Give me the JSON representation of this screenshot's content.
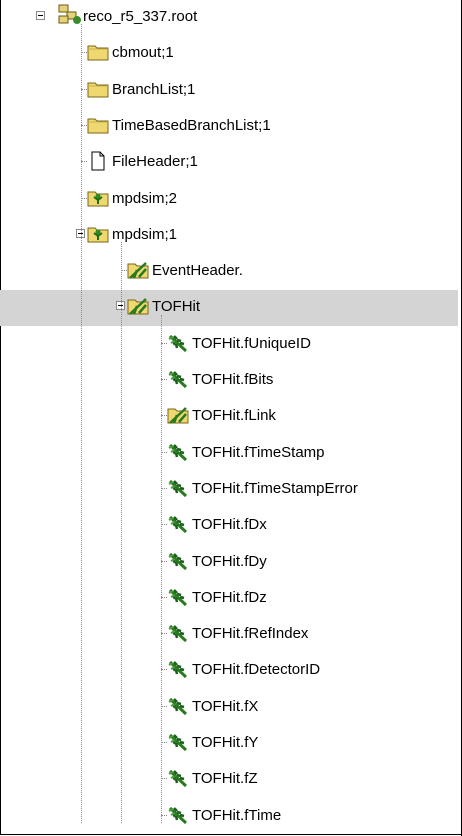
{
  "tree": {
    "root": {
      "label": "reco_r5_337.root",
      "icon": "root-file-icon",
      "expanded": true
    },
    "items": [
      {
        "label": "cbmout;1",
        "icon": "folder-icon"
      },
      {
        "label": "BranchList;1",
        "icon": "folder-icon"
      },
      {
        "label": "TimeBasedBranchList;1",
        "icon": "folder-icon"
      },
      {
        "label": "FileHeader;1",
        "icon": "file-icon"
      },
      {
        "label": "mpdsim;2",
        "icon": "tree-icon"
      },
      {
        "label": "mpdsim;1",
        "icon": "tree-icon",
        "expanded": true,
        "children": [
          {
            "label": "EventHeader.",
            "icon": "branch-icon"
          },
          {
            "label": "TOFHit",
            "icon": "branch-icon",
            "expanded": true,
            "selected": true,
            "children": [
              {
                "label": "TOFHit.fUniqueID",
                "icon": "leaf-icon"
              },
              {
                "label": "TOFHit.fBits",
                "icon": "leaf-icon"
              },
              {
                "label": "TOFHit.fLink",
                "icon": "branch-icon"
              },
              {
                "label": "TOFHit.fTimeStamp",
                "icon": "leaf-icon"
              },
              {
                "label": "TOFHit.fTimeStampError",
                "icon": "leaf-icon"
              },
              {
                "label": "TOFHit.fDx",
                "icon": "leaf-icon"
              },
              {
                "label": "TOFHit.fDy",
                "icon": "leaf-icon"
              },
              {
                "label": "TOFHit.fDz",
                "icon": "leaf-icon"
              },
              {
                "label": "TOFHit.fRefIndex",
                "icon": "leaf-icon"
              },
              {
                "label": "TOFHit.fDetectorID",
                "icon": "leaf-icon"
              },
              {
                "label": "TOFHit.fX",
                "icon": "leaf-icon"
              },
              {
                "label": "TOFHit.fY",
                "icon": "leaf-icon"
              },
              {
                "label": "TOFHit.fZ",
                "icon": "leaf-icon"
              },
              {
                "label": "TOFHit.fTime",
                "icon": "leaf-icon"
              }
            ]
          }
        ]
      }
    ]
  },
  "colors": {
    "selection": "#d4d4d4",
    "folder": "#f0d870",
    "leaf": "#2a7a20",
    "connector": "#8a8a8a"
  }
}
